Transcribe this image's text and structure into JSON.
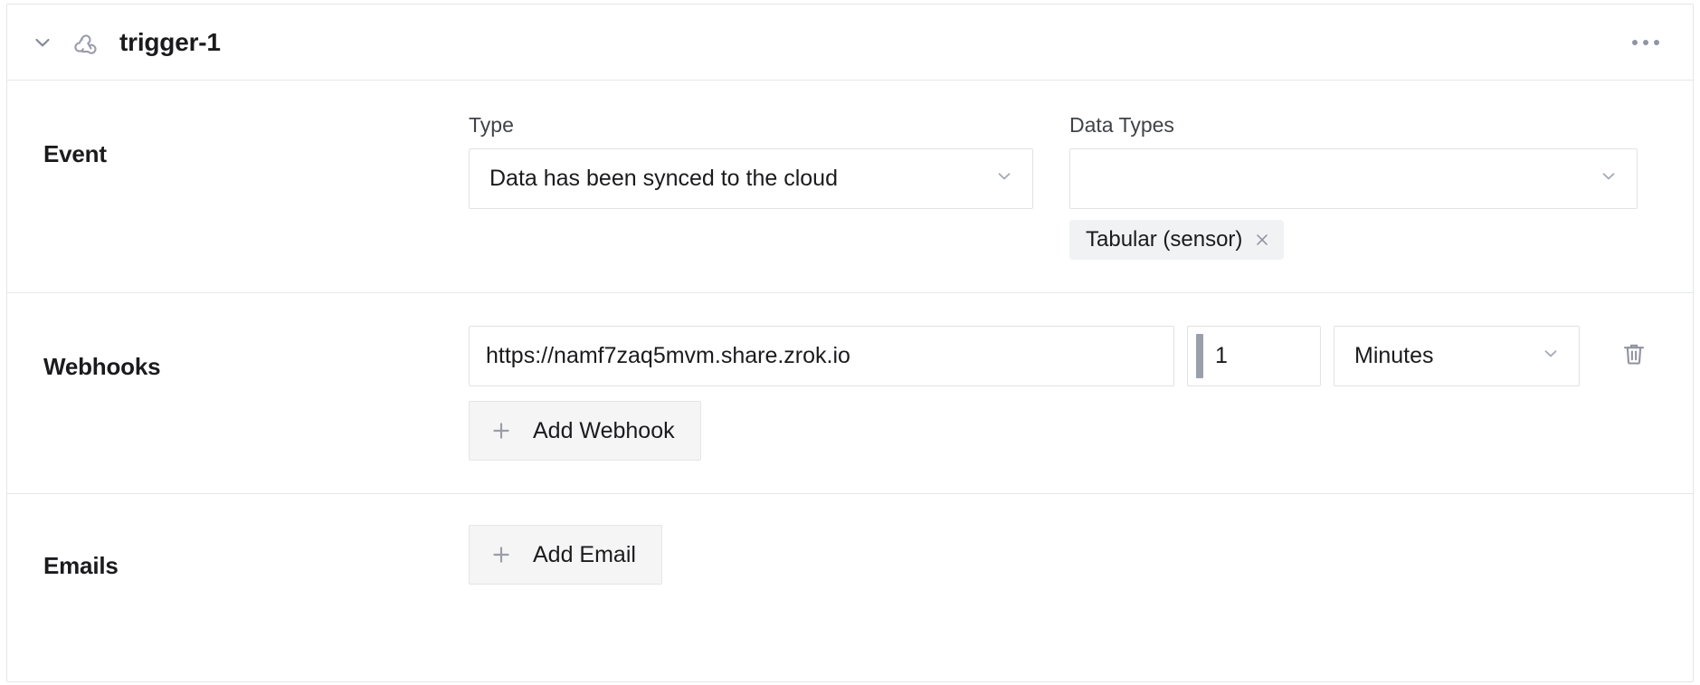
{
  "header": {
    "title": "trigger-1",
    "collapse_icon": "chevron-down-icon",
    "trigger_icon": "webhook-icon",
    "menu_icon": "ellipsis-horizontal-icon"
  },
  "event": {
    "section_label": "Event",
    "type": {
      "label": "Type",
      "value": "Data has been synced to the cloud",
      "caret_icon": "chevron-down-icon"
    },
    "data_types": {
      "label": "Data Types",
      "value": "",
      "placeholder": "",
      "caret_icon": "chevron-down-icon",
      "chips": [
        {
          "label": "Tabular (sensor)",
          "remove_icon": "close-icon"
        }
      ]
    }
  },
  "webhooks": {
    "section_label": "Webhooks",
    "rows": [
      {
        "url": "https://namf7zaq5mvm.share.zrok.io",
        "url_placeholder": "",
        "interval": "1",
        "interval_placeholder": "",
        "unit": "Minutes",
        "unit_caret_icon": "chevron-down-icon",
        "delete_icon": "trash-icon"
      }
    ],
    "add_label": "Add Webhook",
    "add_icon": "plus-icon"
  },
  "emails": {
    "section_label": "Emails",
    "add_label": "Add Email",
    "add_icon": "plus-icon"
  },
  "colors": {
    "text_primary": "#1b1b1e",
    "text_secondary": "#404349",
    "border": "#e1e2e4",
    "divider": "#e6e7e9",
    "icon_gray": "#9194a1",
    "chip_bg": "#f1f2f4",
    "button_bg": "#f5f5f6"
  }
}
